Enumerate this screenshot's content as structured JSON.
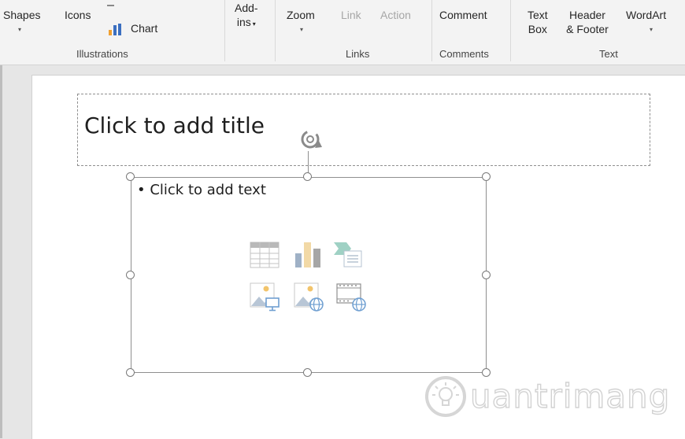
{
  "ribbon": {
    "shapes_label": "Shapes",
    "icons_label": "Icons",
    "chart_label": "Chart",
    "illustrations_group": "Illustrations",
    "addins_line1": "Add-",
    "addins_line2": "ins",
    "zoom_label": "Zoom",
    "link_label": "Link",
    "action_label": "Action",
    "links_group": "Links",
    "comment_label": "Comment",
    "comments_group": "Comments",
    "textbox_line1": "Text",
    "textbox_line2": "Box",
    "header_line1": "Header",
    "header_line2": "& Footer",
    "wordart_label": "WordArt",
    "text_group": "Text",
    "dropdown_glyph": "▾"
  },
  "slide": {
    "title_placeholder": "Click to add title",
    "content_placeholder": "• Click to add text"
  },
  "content_icons": [
    "table-icon",
    "chart-icon",
    "smartart-icon",
    "pictures-icon",
    "online-pictures-icon",
    "video-icon"
  ],
  "watermark": {
    "text": "uantrimang"
  },
  "colors": {
    "ribbon_bg": "#f3f3f3",
    "workspace_bg": "#e6e6e6",
    "slide_bg": "#ffffff",
    "disabled_text": "#a6a6a6"
  }
}
